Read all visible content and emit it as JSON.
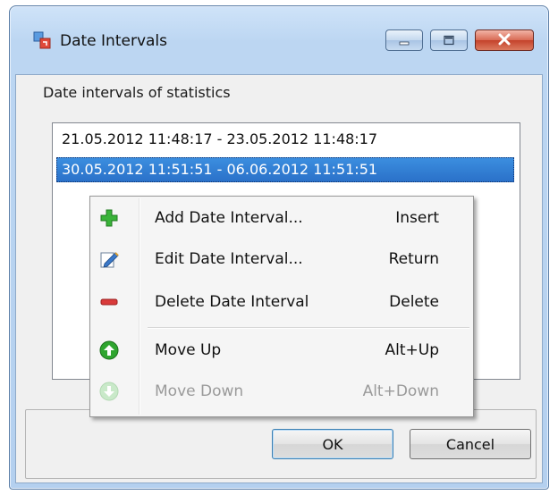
{
  "window": {
    "title": "Date Intervals",
    "title_icon": "date-intervals-app-icon"
  },
  "caption_buttons": {
    "minimize": "minimize-icon",
    "maximize": "maximize-icon",
    "close": "close-icon"
  },
  "group": {
    "label": "Date intervals of statistics"
  },
  "list": {
    "items": [
      {
        "text": "21.05.2012 11:48:17 - 23.05.2012 11:48:17",
        "selected": false
      },
      {
        "text": "30.05.2012 11:51:51 - 06.06.2012 11:51:51",
        "selected": true
      }
    ]
  },
  "context_menu": {
    "items": [
      {
        "label": "Add Date Interval...",
        "shortcut": "Insert",
        "icon": "plus-icon",
        "enabled": true
      },
      {
        "label": "Edit Date Interval...",
        "shortcut": "Return",
        "icon": "edit-icon",
        "enabled": true
      },
      {
        "label": "Delete Date Interval",
        "shortcut": "Delete",
        "icon": "minus-icon",
        "enabled": true
      },
      {
        "label": "Move Up",
        "shortcut": "Alt+Up",
        "icon": "arrow-up-icon",
        "enabled": true
      },
      {
        "label": "Move Down",
        "shortcut": "Alt+Down",
        "icon": "arrow-down-icon",
        "enabled": false
      }
    ]
  },
  "buttons": {
    "ok": "OK",
    "cancel": "Cancel"
  },
  "colors": {
    "selection": "#3399ff",
    "titlebar": "#bcd6f2",
    "plus": "#2ea52e",
    "minus": "#d42a2a"
  }
}
